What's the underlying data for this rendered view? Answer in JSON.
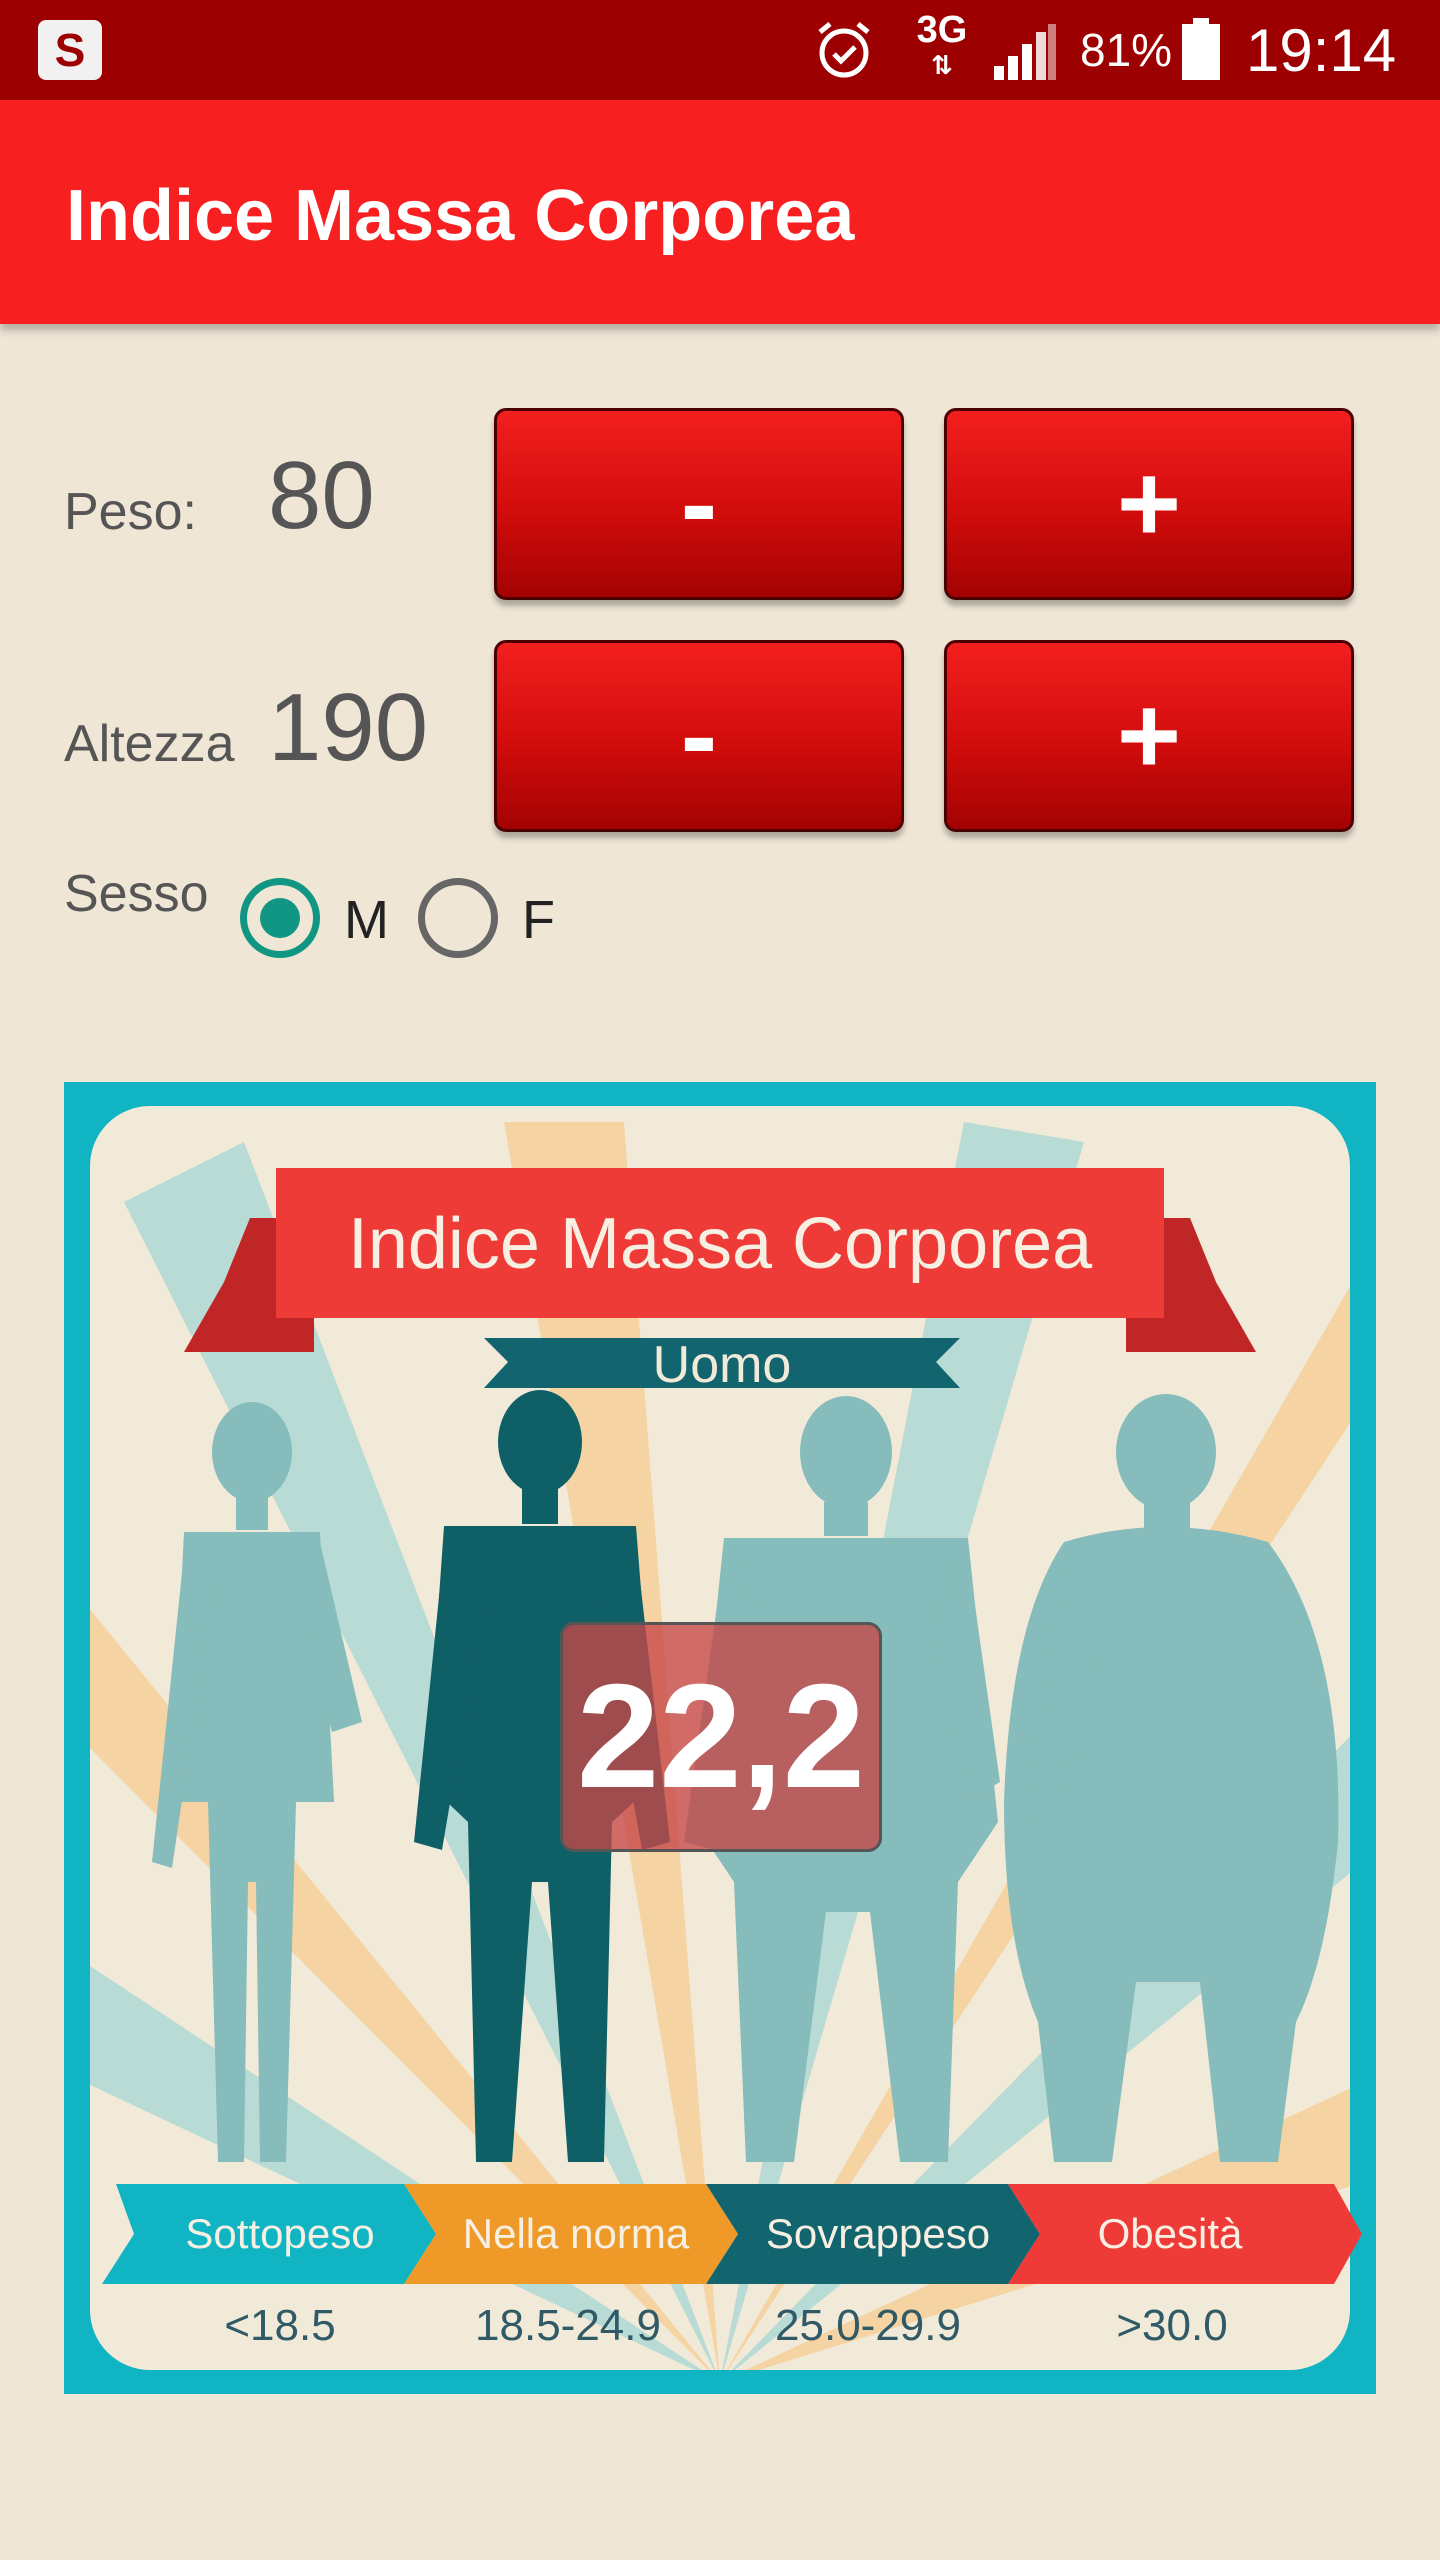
{
  "status_bar": {
    "network": "3G",
    "battery": "81%",
    "time": "19:14"
  },
  "app_bar": {
    "title": "Indice Massa Corporea"
  },
  "form": {
    "peso_label": "Peso:",
    "peso_value": "80",
    "altezza_label": "Altezza",
    "altezza_value": "190",
    "minus_label": "-",
    "plus_label": "+",
    "sesso_label": "Sesso",
    "sex_options": [
      "M",
      "F"
    ],
    "sex_selected": "M"
  },
  "illustration": {
    "title": "Indice Massa Corporea",
    "subtitle": "Uomo",
    "bmi_value": "22,2",
    "categories": [
      {
        "name": "Sottopeso",
        "range": "<18.5",
        "color": "#10b4c2"
      },
      {
        "name": "Nella norma",
        "range": "18.5-24.9",
        "color": "#ef9a28"
      },
      {
        "name": "Sovrappeso",
        "range": "25.0-29.9",
        "color": "#12646f"
      },
      {
        "name": "Obesità",
        "range": ">30.0",
        "color": "#ee3b38"
      }
    ]
  },
  "colors": {
    "status_bar": "#9c0000",
    "app_bar": "#f71f20",
    "background": "#efe6d6",
    "radio_checked": "#109682",
    "figure_light": "#86bcbb",
    "figure_dark": "#0f5f66"
  }
}
